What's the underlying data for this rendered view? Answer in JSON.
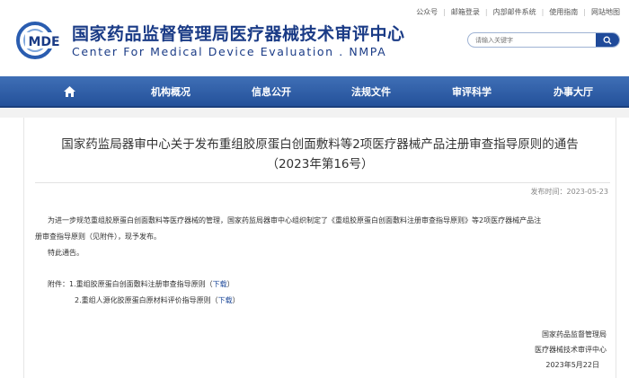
{
  "top_links": [
    "公众号",
    "邮箱登录",
    "内部邮件系统",
    "使用指南",
    "网站地图"
  ],
  "header": {
    "logo_text": "MDE",
    "title": "国家药品监督管理局医疗器械技术审评中心",
    "subtitle": "Center For Medical Device Evaluation . NMPA",
    "search_placeholder": "请输入关键字"
  },
  "nav": {
    "home_icon": "home-icon",
    "items": [
      "机构概况",
      "信息公开",
      "法规文件",
      "审评科学",
      "办事大厅"
    ]
  },
  "article": {
    "title_line1": "国家药监局器审中心关于发布重组胶原蛋白创面敷料等2项医疗器械产品注册审查指导原则的通告",
    "title_line2": "（2023年第16号）",
    "publish_date": "发布时间：2023-05-23",
    "para1_line1": "为进一步规范重组胶原蛋白创面敷料等医疗器械的管理，国家药监局器审中心组织制定了《重组胶原蛋白创面敷料注册审查指导原则》等2项医疗器械产品注",
    "para1_line2": "册审查指导原则（见附件），现予发布。",
    "para2": "特此通告。",
    "attachments_label": "附件：",
    "attachments": [
      {
        "text": "1.重组胶原蛋白创面敷料注册审查指导原则",
        "link": "下载"
      },
      {
        "text": "2.重组人源化胶原蛋白原材料评价指导原则",
        "link": "下载"
      }
    ],
    "signature": [
      "国家药品监督管理局",
      "医疗器械技术审评中心",
      "2023年5月22日"
    ]
  },
  "colors": {
    "brand": "#1a3b86",
    "nav": "#2d5ca6",
    "link": "#1f4a9a"
  }
}
